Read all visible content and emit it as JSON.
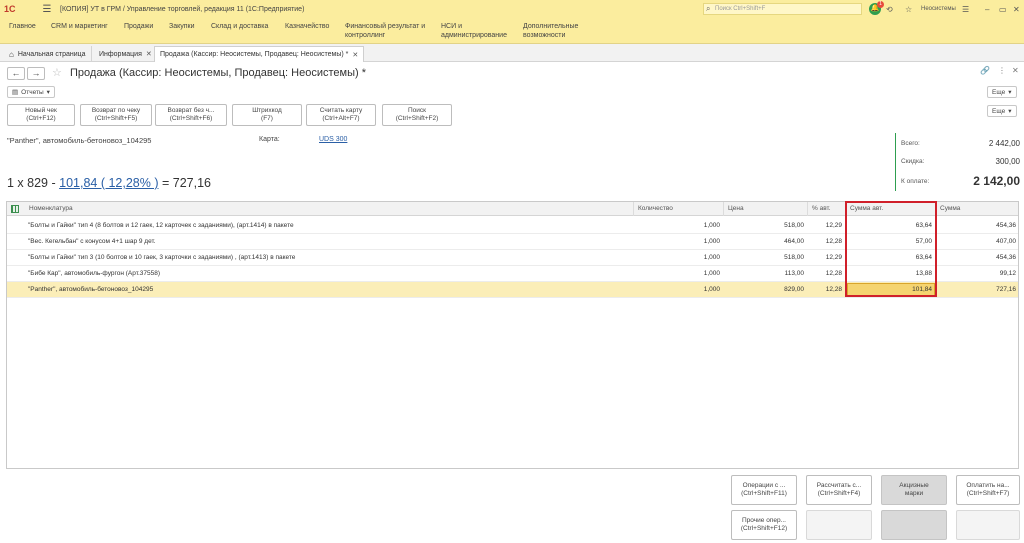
{
  "app": {
    "logo": "1С",
    "title": "[КОПИЯ] УТ в ГРМ / Управление торговлей, редакция 11  (1С:Предприятие)",
    "search_placeholder": "Поиск Ctrl+Shift+F",
    "notifications_count": "1",
    "user": "Неосистемы"
  },
  "menu": {
    "items": [
      "Главное",
      "CRM и маркетинг",
      "Продажи",
      "Закупки",
      "Склад и доставка",
      "Казначейство"
    ],
    "item_fin_1": "Финансовый результат и",
    "item_fin_2": "контроллинг",
    "item_nsi_1": "НСИ и",
    "item_nsi_2": "администрирование",
    "item_extra_1": "Дополнительные",
    "item_extra_2": "возможности"
  },
  "tabs": {
    "home": "Начальная страница",
    "info": "Информация",
    "sale": "Продажа (Кассир: Неосистемы, Продавец: Неосистемы) *"
  },
  "form": {
    "title": "Продажа (Кассир: Неосистемы, Продавец: Неосистемы) *",
    "reports": "Отчеты",
    "more": "Еще"
  },
  "toolbar": [
    {
      "l1": "Новый чек",
      "l2": "(Ctrl+F12)"
    },
    {
      "l1": "Возврат по чеку",
      "l2": "(Ctrl+Shift+F5)"
    },
    {
      "l1": "Возврат без ч...",
      "l2": "(Ctrl+Shift+F6)"
    },
    {
      "l1": "Штрихкод",
      "l2": "(F7)"
    },
    {
      "l1": "Считать карту",
      "l2": "(Ctrl+Alt+F7)"
    },
    {
      "l1": "Поиск",
      "l2": "(Ctrl+Shift+F2)"
    }
  ],
  "item_info": {
    "product": "\"Panther\", автомобиль-бетоновоз_104295",
    "card_label": "Карта:",
    "card_value": "UDS 300"
  },
  "formula": {
    "qty_price": "1 x 829 -",
    "discount": "101,84 ( 12,28% )",
    "result": "= 727,16"
  },
  "totals": {
    "total_label": "Всего:",
    "total_value": "2 442,00",
    "discount_label": "Скидка:",
    "discount_value": "300,00",
    "pay_label": "К оплате:",
    "pay_value": "2 142,00"
  },
  "table": {
    "columns": [
      "Номенклатура",
      "Количество",
      "Цена",
      "% авт.",
      "Сумма авт.",
      "Сумма"
    ],
    "rows": [
      [
        "\"Болты и Гайки\" тип 4 (8 болтов и 12 гаек, 12  карточек с заданиями), (арт.1414) в пакете",
        "1,000",
        "518,00",
        "12,29",
        "63,64",
        "454,36"
      ],
      [
        "\"Вес. Кегельбан\" с конусом 4+1 шар 9 дет.",
        "1,000",
        "464,00",
        "12,28",
        "57,00",
        "407,00"
      ],
      [
        "\"Болты и Гайки\" тип 3 (10 болтов и 10 гаек, 3 карточки с заданиями) , (арт.1413) в пакете",
        "1,000",
        "518,00",
        "12,29",
        "63,64",
        "454,36"
      ],
      [
        "\"Бибе Кар\", автомобиль-фургон (Арт.37558)",
        "1,000",
        "113,00",
        "12,28",
        "13,88",
        "99,12"
      ],
      [
        "\"Panther\", автомобиль-бетоновоз_104295",
        "1,000",
        "829,00",
        "12,28",
        "101,84",
        "727,16"
      ]
    ]
  },
  "bottom_buttons": {
    "ops_1": "Операции с ...",
    "ops_2": "(Ctrl+Shift+F11)",
    "calc_1": "Рассчитать с...",
    "calc_2": "(Ctrl+Shift+F4)",
    "excise_1": "Акцизные",
    "excise_2": "марки",
    "pay_1": "Оплатить на...",
    "pay_2": "(Ctrl+Shift+F7)",
    "other_1": "Прочие опер...",
    "other_2": "(Ctrl+Shift+F12)"
  }
}
